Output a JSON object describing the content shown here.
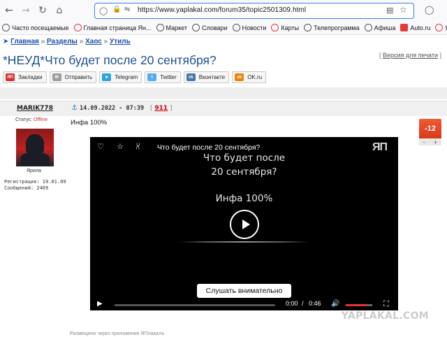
{
  "browser": {
    "url": "https://www.yaplakal.com/forum35/topic2501309.html"
  },
  "bookmarks": [
    {
      "label": "Часто посещаемые",
      "icon": "gear-icon"
    },
    {
      "label": "Главная страница Ян...",
      "icon": "yandex-icon"
    },
    {
      "label": "Маркет",
      "icon": "globe-icon"
    },
    {
      "label": "Словари",
      "icon": "globe-icon"
    },
    {
      "label": "Новости",
      "icon": "globe-icon"
    },
    {
      "label": "Карты",
      "icon": "map-pin-icon"
    },
    {
      "label": "Телепрограмма",
      "icon": "globe-icon"
    },
    {
      "label": "Афиша",
      "icon": "globe-icon"
    },
    {
      "label": "Auto.ru",
      "icon": "auto-icon"
    },
    {
      "label": "Яндекс",
      "icon": "yandex-icon"
    }
  ],
  "breadcrumb": {
    "home": "Главная",
    "sep1": "»",
    "sections": "Разделы",
    "sep2": "»",
    "chaos": "Хаос",
    "sep3": "»",
    "junk": "Утиль"
  },
  "topic": {
    "title": "*НЕУД*Что будет после 20 сентября?",
    "print_prefix": "[ ",
    "print_link": "Версия для печати",
    "print_suffix": " ]"
  },
  "share_buttons": [
    {
      "label": "Закладки",
      "color": "#d32f2f",
      "glyph": "ЯП"
    },
    {
      "label": "Отправить",
      "color": "#9e9e9e",
      "glyph": "✉"
    },
    {
      "label": "Telegram",
      "color": "#2aa3de",
      "glyph": "➤"
    },
    {
      "label": "Twitter",
      "color": "#55acee",
      "glyph": "t"
    },
    {
      "label": "Вконтакте",
      "color": "#4a76a8",
      "glyph": "vk"
    },
    {
      "label": "OK.ru",
      "color": "#ee8208",
      "glyph": "ok"
    }
  ],
  "post": {
    "username": "MARIK778",
    "date": "14.09.2022 - 07:39",
    "num_open": "[ ",
    "number": "911",
    "num_close": " ]",
    "status_label": "Статус:",
    "status_value": "Offline",
    "rank": "Ярила",
    "registration": "Регистрация: 19.01.09",
    "messages": "Сообщений: 2409",
    "text": "Инфа 100%",
    "rating": "-12",
    "footer": "Размещено через приложение  ЯПлакалъ"
  },
  "video": {
    "title": "Что будет после 20 сентября?",
    "line1": "Что будет после",
    "line2": "20 сентября?",
    "line3": "Инфа 100%",
    "button": "Слушать внимательно",
    "time_current": "0:00",
    "time_sep": "/",
    "time_total": "0:46",
    "volume_level": 0.8,
    "logo_text": "ЯП"
  },
  "watermark": "YAPLAKAL.COM"
}
